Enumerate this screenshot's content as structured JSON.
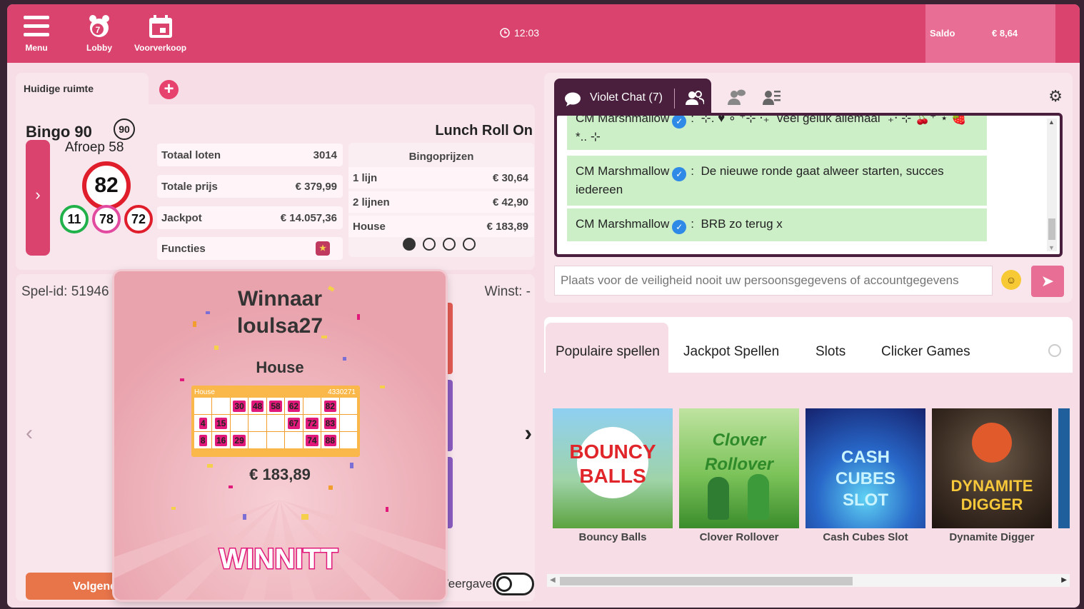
{
  "topbar": {
    "menu_label": "Menu",
    "lobby_label": "Lobby",
    "voorverkoop_label": "Voorverkoop",
    "time": "12:03",
    "saldo_label": "Saldo",
    "saldo_value": "€ 8,64"
  },
  "room": {
    "tab_label": "Huidige ruimte",
    "add_icon": "+",
    "game_name": "Bingo 90",
    "game_badge": "90",
    "afroep": "Afroep 58",
    "current_ball": "82",
    "previous_balls": [
      "11",
      "78",
      "72"
    ],
    "stats": [
      {
        "label": "Totaal loten",
        "value": "3014"
      },
      {
        "label": "Totale prijs",
        "value": "€ 379,99"
      },
      {
        "label": "Jackpot",
        "value": "€ 14.057,36"
      },
      {
        "label": "Functies",
        "value": ""
      }
    ],
    "room_name": "Lunch Roll On",
    "prizes_title": "Bingoprijzen",
    "prizes": [
      {
        "label": "1 lijn",
        "value": "€ 30,64"
      },
      {
        "label": "2 lijnen",
        "value": "€ 42,90"
      },
      {
        "label": "House",
        "value": "€ 183,89"
      }
    ],
    "carousel_active_index": 0,
    "carousel_count": 4
  },
  "game": {
    "spel_id": "Spel-id: 51946",
    "winst": "Winst:  -",
    "volgende_label": "Volgende",
    "weergave_label": "Weergave",
    "toggle_on": false
  },
  "winner": {
    "title": "Winnaar",
    "username": "loulsa27",
    "prize_type": "House",
    "ticket_label": "House",
    "ticket_id": "4330271",
    "ticket_rows": [
      [
        "",
        "",
        "30",
        "48",
        "58",
        "62",
        "",
        "82"
      ],
      [
        "4",
        "15",
        "",
        "",
        "",
        "67",
        "72",
        "83"
      ],
      [
        "8",
        "16",
        "29",
        "",
        "",
        "",
        "74",
        "88"
      ]
    ],
    "amount": "€ 183,89",
    "logo_text": "WINNITT"
  },
  "chat": {
    "tab_label": "Violet Chat (7)",
    "messages": [
      {
        "user": "CM Marshmallow",
        "text": "⊹.  ♥ ∘ ⁺⊹ ‧₊˚ veel geluk allemaal ˚₊‧ ⊹ 🍒⁺˚⋆ 🍓 *.. ⊹"
      },
      {
        "user": "CM Marshmallow",
        "text": "De nieuwe ronde gaat alweer starten, succes iedereen"
      },
      {
        "user": "CM Marshmallow",
        "text": "BRB zo terug x"
      }
    ],
    "input_placeholder": "Plaats voor de veiligheid nooit uw persoonsgegevens of accountgegevens"
  },
  "games": {
    "tabs": [
      "Populaire spellen",
      "Jackpot Spellen",
      "Slots",
      "Clicker Games"
    ],
    "active_tab": 0,
    "items": [
      {
        "title": "Bouncy Balls",
        "art": "BOUNCY BALLS"
      },
      {
        "title": "Clover Rollover",
        "art": "Clover Rollover"
      },
      {
        "title": "Cash Cubes Slot",
        "art": "CASH CUBES SLOT"
      },
      {
        "title": "Dynamite Digger",
        "art": "DYNAMITE DIGGER"
      }
    ]
  },
  "colors": {
    "brand": "#d9436e",
    "chat_dark": "#4a1f3d",
    "chat_message_bg": "#ccefc8",
    "ball_ring_current": "#e01d2a",
    "ball_rings": [
      "#21b14a",
      "#e24aa0",
      "#e01d2a"
    ]
  }
}
